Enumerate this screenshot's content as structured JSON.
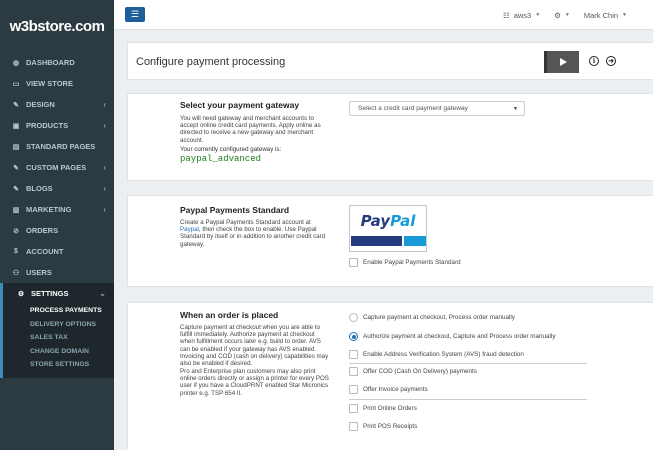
{
  "brand": {
    "logo": "w3bstore.com"
  },
  "sidebar": {
    "items": [
      {
        "label": "DASHBOARD",
        "icon": "dashboard-icon",
        "glyph": "◍",
        "caret": ""
      },
      {
        "label": "VIEW STORE",
        "icon": "monitor-icon",
        "glyph": "▭",
        "caret": ""
      },
      {
        "label": "DESIGN",
        "icon": "brush-icon",
        "glyph": "✎",
        "caret": "‹"
      },
      {
        "label": "PRODUCTS",
        "icon": "box-icon",
        "glyph": "▣",
        "caret": "‹"
      },
      {
        "label": "STANDARD PAGES",
        "icon": "file-icon",
        "glyph": "▤",
        "caret": ""
      },
      {
        "label": "CUSTOM PAGES",
        "icon": "pencil-icon",
        "glyph": "✎",
        "caret": "‹"
      },
      {
        "label": "BLOGS",
        "icon": "pencil-icon",
        "glyph": "✎",
        "caret": "‹"
      },
      {
        "label": "MARKETING",
        "icon": "chart-icon",
        "glyph": "▥",
        "caret": "‹"
      },
      {
        "label": "ORDERS",
        "icon": "link-icon",
        "glyph": "⊘",
        "caret": ""
      },
      {
        "label": "ACCOUNT",
        "icon": "dollar-icon",
        "glyph": "$",
        "caret": ""
      },
      {
        "label": "USERS",
        "icon": "users-icon",
        "glyph": "⚇",
        "caret": ""
      },
      {
        "label": "SETTINGS",
        "icon": "gear-icon",
        "glyph": "⚙",
        "caret": "⌄"
      }
    ],
    "settings_sub": [
      {
        "label": "PROCESS PAYMENTS",
        "active": true
      },
      {
        "label": "DELIVERY OPTIONS",
        "active": false
      },
      {
        "label": "SALES TAX",
        "active": false
      },
      {
        "label": "CHANGE DOMAIN",
        "active": false
      },
      {
        "label": "STORE SETTINGS",
        "active": false
      }
    ]
  },
  "topbar": {
    "menu_icon": "menu-icon",
    "store": "aws3",
    "user": "Mark Chin"
  },
  "header": {
    "title": "Configure payment processing"
  },
  "gateway": {
    "title": "Select your payment gateway",
    "text": "You will need gateway and merchant accounts to accept online credit card payments. Apply online as directed to receive a new gateway and merchant account.",
    "current_label": "Your currently configured gateway is:",
    "current_value": "paypal_advanced",
    "select_placeholder": "Select a credit card payment gateway"
  },
  "paypal": {
    "title": "Paypal Payments Standard",
    "text_pre": "Create a Paypal Payments Standard account at ",
    "link": "Paypal",
    "text_post": ", then check the box to enable. Use Paypal Standard by itself or in addition to another credit card gateway.",
    "logo_w1": "Pay",
    "logo_w2": "Pal",
    "enable_label": "Enable Paypal Payments Standard"
  },
  "order": {
    "title": "When an order is placed",
    "text1": "Capture payment at checkout when you are able to fulfill immediately. Authorize payment at checkout when fulfillment occurs later e.g. build to order. AVS can be enabled if your gateway has AVS enabled. Invoicing and COD (cash on delivery) capabilities may also be enabled if desired.",
    "text2": "Pro and Enterprise plan customers may also print online orders directly or assign a printer for every POS user if you have a CloudPRNT enabled Star Micronics printer e.g. TSP 654 II.",
    "opt_capture": "Capture payment at checkout, Process order manually",
    "opt_authorize": "Authorize payment at checkout, Capture and Process order manually",
    "opt_avs": "Enable Address Verification System (AVS) fraud detection",
    "opt_cod": "Offer COD (Cash On Delivery) payments",
    "opt_invoice": "Offer Invoice payments",
    "opt_print": "Print Online Orders",
    "opt_pos": "Print POS Receipts"
  }
}
